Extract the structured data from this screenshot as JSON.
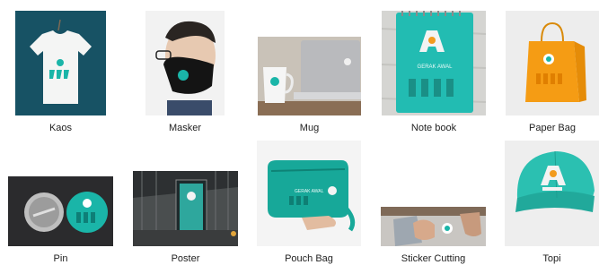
{
  "gallery": {
    "items": [
      {
        "label": "Kaos",
        "icon": "tshirt-thumbnail"
      },
      {
        "label": "Masker",
        "icon": "face-mask-thumbnail"
      },
      {
        "label": "Mug",
        "icon": "mug-thumbnail"
      },
      {
        "label": "Note book",
        "icon": "notebook-thumbnail"
      },
      {
        "label": "Paper Bag",
        "icon": "paper-bag-thumbnail"
      },
      {
        "label": "Pin",
        "icon": "pin-thumbnail"
      },
      {
        "label": "Poster",
        "icon": "poster-thumbnail"
      },
      {
        "label": "Pouch Bag",
        "icon": "pouch-bag-thumbnail"
      },
      {
        "label": "Sticker Cutting",
        "icon": "sticker-thumbnail"
      },
      {
        "label": "Topi",
        "icon": "cap-thumbnail"
      }
    ],
    "brand": {
      "text": "GERAK AWAL",
      "accent": "#1ab5a8",
      "dark": "#0c3c52"
    }
  }
}
